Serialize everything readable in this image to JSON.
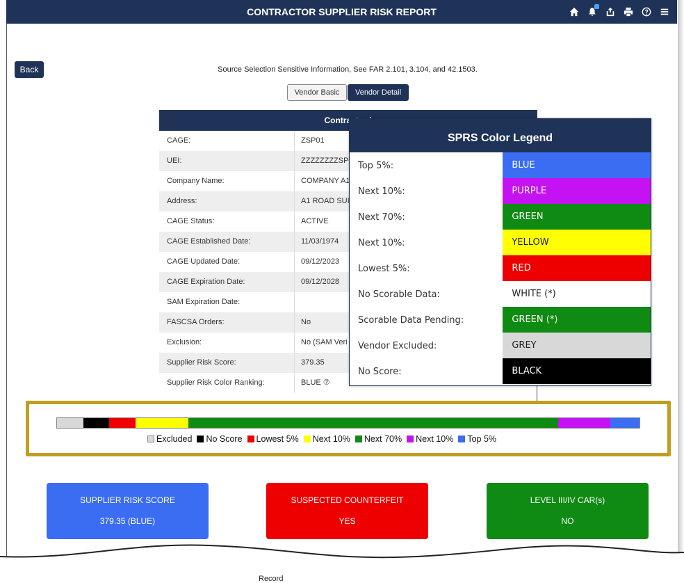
{
  "header": {
    "title": "CONTRACTOR SUPPLIER RISK REPORT",
    "icons": [
      "home-icon",
      "bell-icon",
      "share-icon",
      "print-icon",
      "help-icon",
      "menu-icon"
    ]
  },
  "back_label": "Back",
  "source_note": "Source Selection Sensitive Information, See FAR 2.101, 3.104, and 42.1503.",
  "tabs": {
    "basic": "Vendor Basic",
    "detail": "Vendor Detail"
  },
  "info_table": {
    "title": "Contractor I",
    "rows": [
      {
        "label": "CAGE:",
        "value": "ZSP01"
      },
      {
        "label": "UEI:",
        "value": "ZZZZZZZZSP0"
      },
      {
        "label": "Company Name:",
        "value": "COMPANY A1"
      },
      {
        "label": "Address:",
        "value": "A1 ROAD SUI"
      },
      {
        "label": "CAGE Status:",
        "value": "ACTIVE"
      },
      {
        "label": "CAGE Established Date:",
        "value": "11/03/1974"
      },
      {
        "label": "CAGE Updated Date:",
        "value": "09/12/2023"
      },
      {
        "label": "CAGE Expiration Date:",
        "value": "09/12/2028"
      },
      {
        "label": "SAM Expiration Date:",
        "value": ""
      },
      {
        "label": "FASCSA Orders:",
        "value": "No"
      },
      {
        "label": "Exclusion:",
        "value": "No (SAM Veri"
      },
      {
        "label": "Supplier Risk Score:",
        "value": "379.35"
      },
      {
        "label": "Supplier Risk Color Ranking:",
        "value": "BLUE ⑦"
      }
    ]
  },
  "legend": {
    "title": "SPRS Color Legend",
    "rows": [
      {
        "label": "Top 5%:",
        "color_name": "BLUE",
        "bg": "#3b6df2",
        "fg": "#ffffff"
      },
      {
        "label": "Next 10%:",
        "color_name": "PURPLE",
        "bg": "#c412f2",
        "fg": "#ffffff"
      },
      {
        "label": "Next 70%:",
        "color_name": "GREEN",
        "bg": "#0f8a12",
        "fg": "#ffffff"
      },
      {
        "label": "Next 10%:",
        "color_name": "YELLOW",
        "bg": "#ffff00",
        "fg": "#222222"
      },
      {
        "label": "Lowest 5%:",
        "color_name": "RED",
        "bg": "#ee0000",
        "fg": "#ffffff"
      },
      {
        "label": "No Scorable Data:",
        "color_name": "WHITE (*)",
        "bg": "#ffffff",
        "fg": "#222222"
      },
      {
        "label": "Scorable Data Pending:",
        "color_name": "GREEN (*)",
        "bg": "#0f8a12",
        "fg": "#ffffff"
      },
      {
        "label": "Vendor Excluded:",
        "color_name": "GREY",
        "bg": "#d8d8d8",
        "fg": "#222222"
      },
      {
        "label": "No Score:",
        "color_name": "BLACK",
        "bg": "#000000",
        "fg": "#ffffff"
      }
    ]
  },
  "color_bar": {
    "segments": [
      {
        "name": "Excluded",
        "color": "#d8d8d8",
        "share": 0.045
      },
      {
        "name": "No Score",
        "color": "#000000",
        "share": 0.045
      },
      {
        "name": "Lowest 5%",
        "color": "#ee0000",
        "share": 0.045
      },
      {
        "name": "Next 10%",
        "color": "#ffff00",
        "share": 0.09
      },
      {
        "name": "Next 70%",
        "color": "#0f8a12",
        "share": 0.635
      },
      {
        "name": "Next 10%",
        "color": "#c412f2",
        "share": 0.09
      },
      {
        "name": "Top 5%",
        "color": "#3b6df2",
        "share": 0.05
      }
    ],
    "legend": [
      {
        "label": "Excluded",
        "color": "#d8d8d8"
      },
      {
        "label": "No Score",
        "color": "#000000"
      },
      {
        "label": "Lowest 5%",
        "color": "#ee0000"
      },
      {
        "label": "Next 10%",
        "color": "#ffff00"
      },
      {
        "label": "Next 70%",
        "color": "#0f8a12"
      },
      {
        "label": "Next 10%",
        "color": "#c412f2"
      },
      {
        "label": "Top 5%",
        "color": "#3b6df2"
      }
    ]
  },
  "cards": [
    {
      "title": "SUPPLIER RISK SCORE",
      "value": "379.35 (BLUE)",
      "color": "#3b6df2"
    },
    {
      "title": "SUSPECTED COUNTERFEIT",
      "value": "YES",
      "color": "#ee0000"
    },
    {
      "title": "LEVEL III/IV CAR(s)",
      "value": "NO",
      "color": "#0f8a12"
    }
  ],
  "bottom_partial_text": "Record"
}
